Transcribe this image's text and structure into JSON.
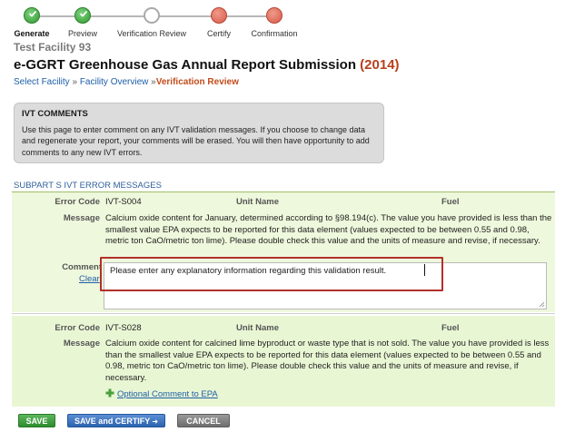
{
  "steps": [
    {
      "label": "Generate",
      "state": "done"
    },
    {
      "label": "Preview",
      "state": "done"
    },
    {
      "label": "Verification Review",
      "state": "current"
    },
    {
      "label": "Certify",
      "state": "todo"
    },
    {
      "label": "Confirmation",
      "state": "todo"
    }
  ],
  "facility_name": "Test Facility 93",
  "report_title": "e-GGRT Greenhouse Gas Annual Report Submission",
  "report_year": "(2014)",
  "breadcrumb": {
    "select_facility": "Select Facility",
    "facility_overview": "Facility Overview",
    "separator": "»",
    "current": "Verification Review"
  },
  "ivt_comments": {
    "heading": "IVT COMMENTS",
    "body": "Use this page to enter comment on any IVT validation messages. If you choose to change data and regenerate your report, your comments will be erased. You will then have opportunity to add comments to any new IVT errors."
  },
  "section_title": "SUBPART S IVT ERROR MESSAGES",
  "labels": {
    "error_code": "Error Code",
    "unit_name": "Unit Name",
    "fuel": "Fuel",
    "message": "Message",
    "comment": "Comment",
    "clear": "Clear"
  },
  "errors": [
    {
      "code": "IVT-S004",
      "message": "Calcium oxide content for January, determined according to §98.194(c). The value you have provided is less than the smallest value EPA expects to be reported for this data element (values expected to be between 0.55 and 0.98, metric ton CaO/metric ton lime). Please double check this value and the units of measure and revise, if necessary.",
      "comment_value": "Please enter any explanatory information regarding this validation result."
    },
    {
      "code": "IVT-S028",
      "message": "Calcium oxide content for calcined lime byproduct or waste type that is not sold. The value you have provided is less than the smallest value EPA expects to be reported for this data element (values expected to be between 0.55 and 0.98, metric ton CaO/metric ton lime). Please double check this value and the units of measure and revise, if necessary.",
      "optional_link": "Optional Comment to EPA"
    }
  ],
  "buttons": {
    "save": "SAVE",
    "save_certify": "SAVE and CERTIFY",
    "cancel": "CANCEL"
  },
  "colors": {
    "done": "#2f9a2f",
    "todo": "#d65a47",
    "link": "#1e5ea8",
    "accent": "#c24b1b",
    "panel": "#eef8dc"
  }
}
